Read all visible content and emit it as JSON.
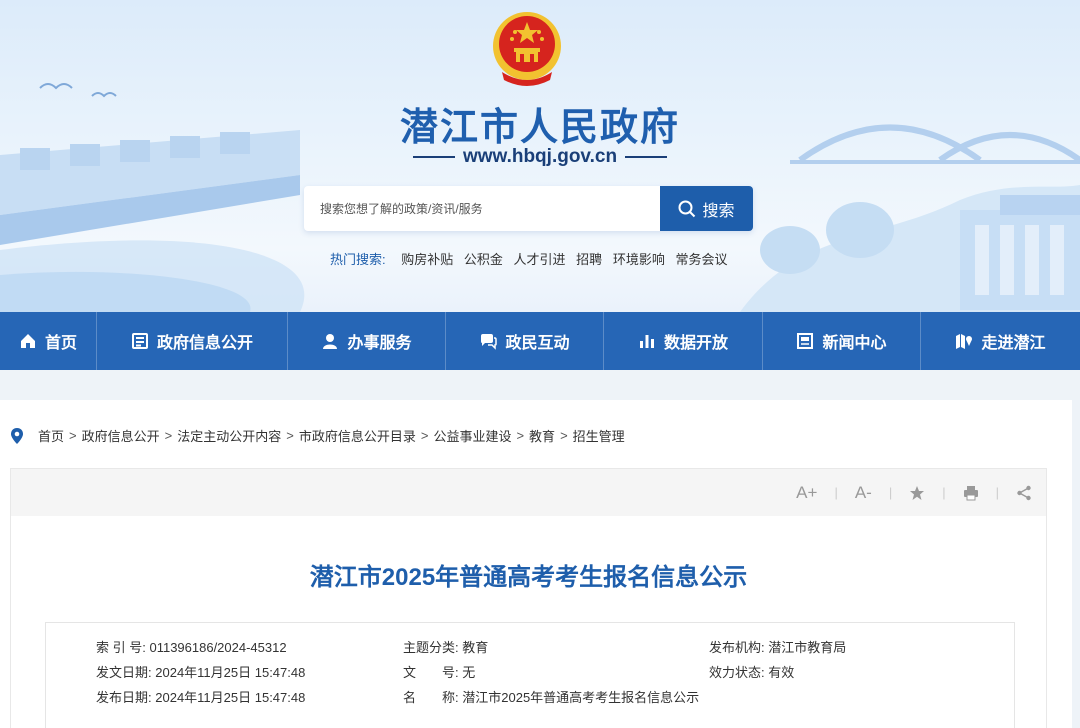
{
  "header": {
    "site_title": "潜江市人民政府",
    "site_url": "www.hbqj.gov.cn"
  },
  "search": {
    "placeholder": "搜索您想了解的政策/资讯/服务",
    "button_label": "搜索",
    "hot_label": "热门搜索:",
    "hot_items": [
      "购房补贴",
      "公积金",
      "人才引进",
      "招聘",
      "环境影响",
      "常务会议"
    ]
  },
  "nav": {
    "items": [
      {
        "label": "首页",
        "icon": "home-icon"
      },
      {
        "label": "政府信息公开",
        "icon": "document-icon"
      },
      {
        "label": "办事服务",
        "icon": "user-service-icon"
      },
      {
        "label": "政民互动",
        "icon": "chat-icon"
      },
      {
        "label": "数据开放",
        "icon": "bar-chart-icon"
      },
      {
        "label": "新闻中心",
        "icon": "news-icon"
      },
      {
        "label": "走进潜江",
        "icon": "map-icon"
      }
    ]
  },
  "breadcrumb": [
    "首页",
    "政府信息公开",
    "法定主动公开内容",
    "市政府信息公开目录",
    "公益事业建设",
    "教育",
    "招生管理"
  ],
  "toolbar": {
    "font_increase": "A+",
    "font_decrease": "A-"
  },
  "article": {
    "title": "潜江市2025年普通高考考生报名信息公示",
    "meta": {
      "index_label": "索 引 号:",
      "index_value": "011396186/2024-45312",
      "category_label": "主题分类:",
      "category_value": "教育",
      "publisher_label": "发布机构:",
      "publisher_value": "潜江市教育局",
      "issue_date_label": "发文日期:",
      "issue_date_value": "2024年11月25日 15:47:48",
      "doc_no_label": "文　　号:",
      "doc_no_value": "无",
      "status_label": "效力状态:",
      "status_value": "有效",
      "publish_date_label": "发布日期:",
      "publish_date_value": "2024年11月25日 15:47:48",
      "name_label": "名　　称:",
      "name_value": "潜江市2025年普通高考考生报名信息公示"
    }
  },
  "colors": {
    "primary": "#2666b6",
    "title_blue": "#1e5eab",
    "emblem_red": "#d6241e",
    "emblem_gold": "#f2c230"
  }
}
